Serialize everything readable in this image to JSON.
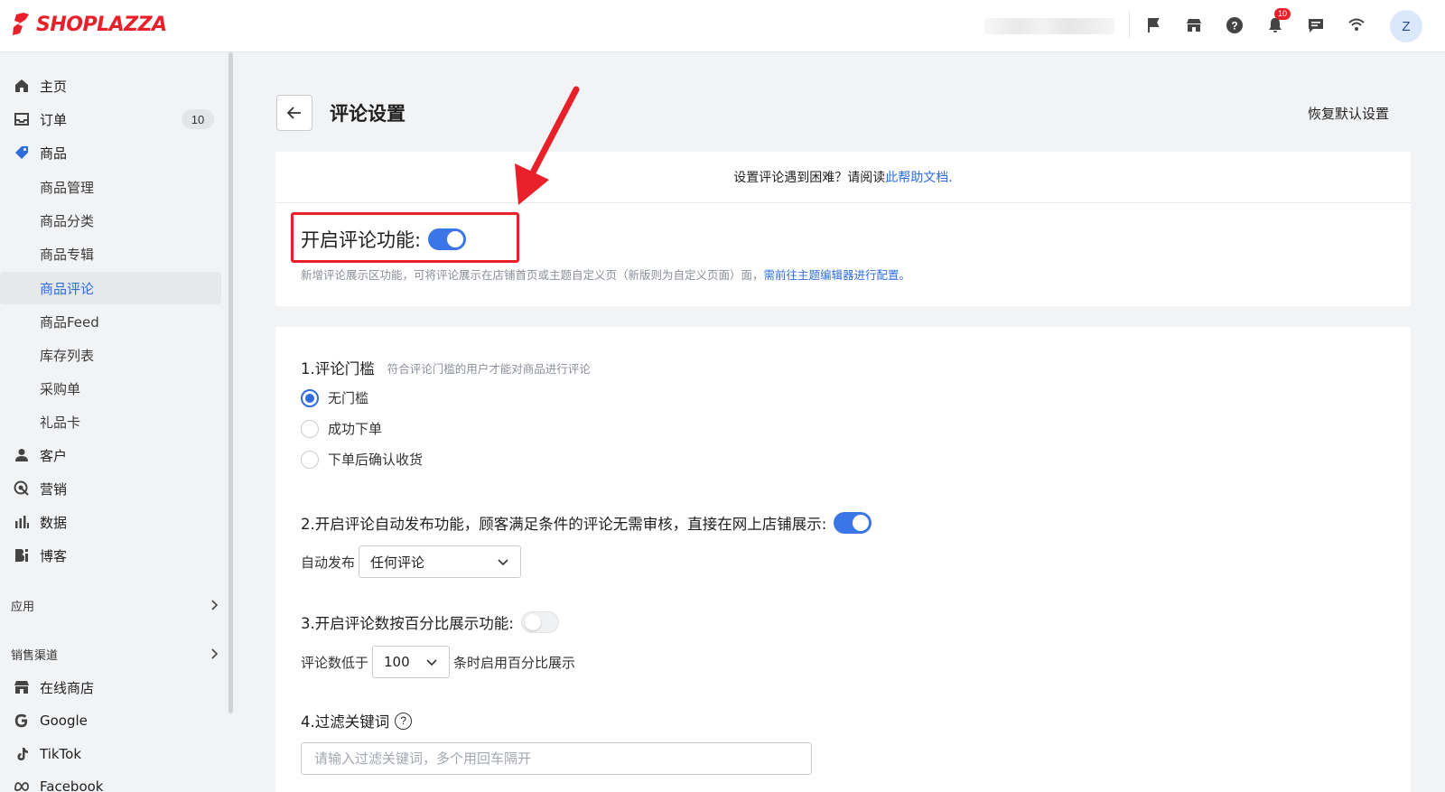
{
  "brand": {
    "name": "SHOPLAZZA",
    "color": "#e8202a"
  },
  "colors": {
    "accent": "#2d6de0",
    "toggle_on": "#3b76e8",
    "highlight": "#e8202a"
  },
  "topbar": {
    "icons": [
      "flag-icon",
      "store-icon",
      "help-icon",
      "bell-icon",
      "chat-icon",
      "wifi-icon"
    ],
    "notification_count": "10",
    "avatar_initial": "Z"
  },
  "sidebar": {
    "items": [
      {
        "label": "主页",
        "icon": "home-icon"
      },
      {
        "label": "订单",
        "icon": "inbox-icon",
        "badge": "10"
      },
      {
        "label": "商品",
        "icon": "tag-icon"
      },
      {
        "label": "商品管理"
      },
      {
        "label": "商品分类"
      },
      {
        "label": "商品专辑"
      },
      {
        "label": "商品评论",
        "active": true
      },
      {
        "label": "商品Feed"
      },
      {
        "label": "库存列表"
      },
      {
        "label": "采购单"
      },
      {
        "label": "礼品卡"
      },
      {
        "label": "客户",
        "icon": "person-icon"
      },
      {
        "label": "营销",
        "icon": "target-icon"
      },
      {
        "label": "数据",
        "icon": "bar-chart-icon"
      },
      {
        "label": "博客",
        "icon": "blog-icon"
      }
    ],
    "sections": [
      {
        "label": "应用"
      },
      {
        "label": "销售渠道"
      }
    ],
    "channels": [
      {
        "label": "在线商店",
        "icon": "store-icon"
      },
      {
        "label": "Google",
        "icon": "google-icon"
      },
      {
        "label": "TikTok",
        "icon": "tiktok-icon"
      },
      {
        "label": "Facebook",
        "icon": "meta-icon"
      }
    ]
  },
  "page": {
    "title": "评论设置",
    "reset_label": "恢复默认设置"
  },
  "help_bar": {
    "text": "设置评论遇到困难？请阅读",
    "link": "此帮助文档."
  },
  "enable_section": {
    "label": "开启评论功能:",
    "enabled": true,
    "hint": "新增评论展示区功能，可将评论展示在店铺首页或主题自定义页（新版则为自定义页面）面，",
    "hint_link": "需前往主题编辑器进行配置。"
  },
  "threshold": {
    "title": "1.评论门槛",
    "subtitle": "符合评论门槛的用户才能对商品进行评论",
    "options": [
      "无门槛",
      "成功下单",
      "下单后确认收货"
    ],
    "selected_index": 0
  },
  "auto_publish": {
    "title": "2.开启评论自动发布功能，顾客满足条件的评论无需审核，直接在网上店铺展示:",
    "enabled": true,
    "field_label": "自动发布",
    "selected": "任何评论"
  },
  "percentage": {
    "title": "3.开启评论数按百分比展示功能:",
    "enabled": false,
    "prefix": "评论数低于",
    "selected": "100",
    "suffix": "条时启用百分比展示"
  },
  "keywords": {
    "title": "4.过滤关键词",
    "help_glyph": "?",
    "placeholder": "请输入过滤关键词，多个用回车隔开"
  }
}
